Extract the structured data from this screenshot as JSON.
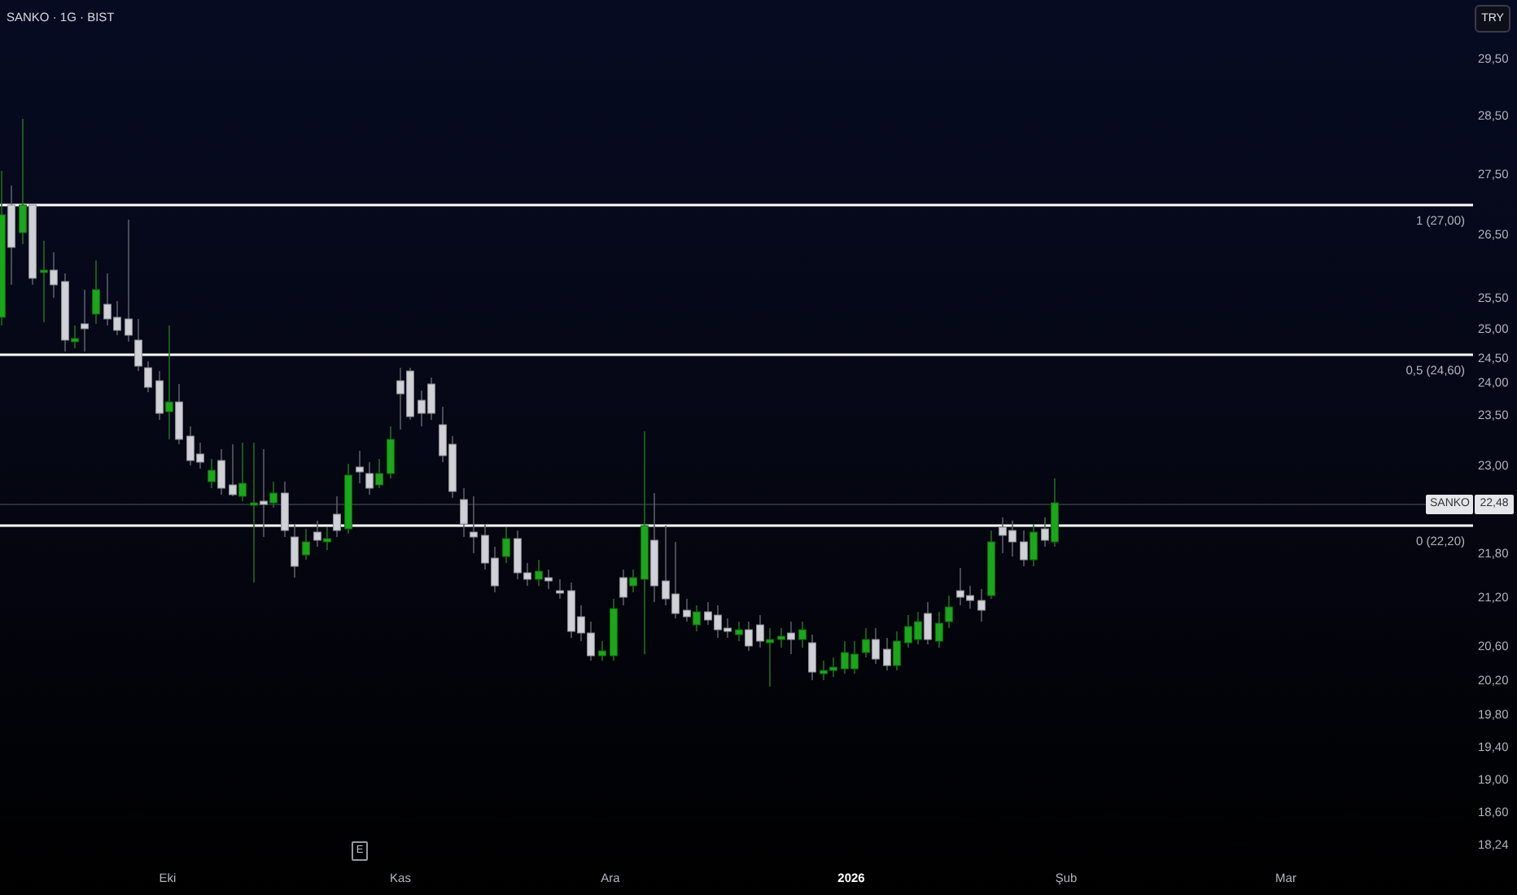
{
  "header": {
    "title": "SANKO · 1G · BIST",
    "currency": "TRY"
  },
  "levels": [
    {
      "label": "1 (27,00)"
    },
    {
      "label": "0,5 (24,60)"
    },
    {
      "label": "0 (22,20)"
    }
  ],
  "price_tag": {
    "symbol": "SANKO",
    "value": "22,48"
  },
  "price_axis": [
    "29,50",
    "28,50",
    "27,50",
    "26,50",
    "25,50",
    "25,00",
    "24,50",
    "24,00",
    "23,50",
    "23,00",
    "21,80",
    "21,20",
    "20,60",
    "20,20",
    "19,80",
    "19,40",
    "19,00",
    "18,60",
    "18,24"
  ],
  "event_marker": "E",
  "time_axis": [
    {
      "label": "Eki",
      "kind": "month"
    },
    {
      "label": "Kas",
      "kind": "month"
    },
    {
      "label": "Ara",
      "kind": "month"
    },
    {
      "label": "2026",
      "kind": "year"
    },
    {
      "label": "Şub",
      "kind": "month"
    },
    {
      "label": "Mar",
      "kind": "month"
    }
  ]
}
